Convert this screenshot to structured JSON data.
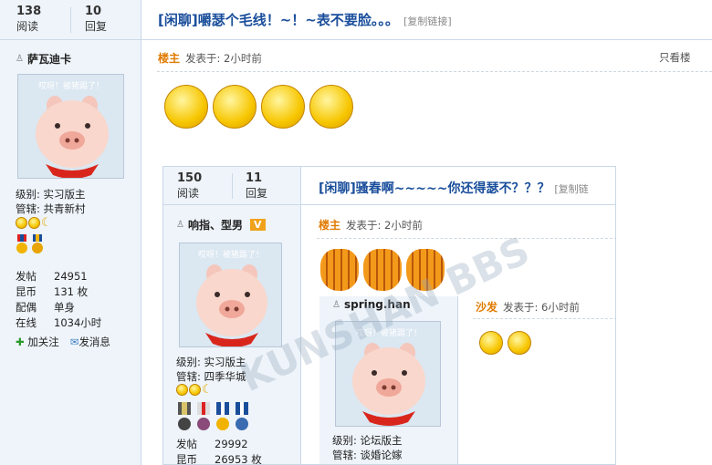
{
  "outer": {
    "stats": {
      "views": "138",
      "views_label": "阅读",
      "replies": "10",
      "replies_label": "回复"
    },
    "title": "[闲聊]嚼瑟个毛线！~！~表不要脸。。。",
    "copy_link": "[复制链接]",
    "user": {
      "name": "萨瓦迪卡",
      "level": "级别: 实习版主",
      "manage": "管辖: 共青新村",
      "posts_k": "发帖",
      "posts_v": "24951",
      "coins_k": "昆币",
      "coins_v": "131 枚",
      "spouse_k": "配偶",
      "spouse_v": "单身",
      "online_k": "在线",
      "online_v": "1034小时",
      "follow": "加关注",
      "message": "发消息"
    },
    "post": {
      "badge": "楼主",
      "meta": "发表于: 2小时前",
      "only_view": "只看楼"
    }
  },
  "mid": {
    "stats": {
      "views": "150",
      "views_label": "阅读",
      "replies": "11",
      "replies_label": "回复"
    },
    "title": "[闲聊]骚春啊~~~~~你还得瑟不？？？",
    "copy_link": "[复制链",
    "user": {
      "name": "响指、型男",
      "vip": "V",
      "level": "级别: 实习版主",
      "manage": "管辖: 四季华城",
      "posts_k": "发帖",
      "posts_v": "29992",
      "coins_k": "昆币",
      "coins_v": "26953 枚"
    },
    "post": {
      "badge": "楼主",
      "meta": "发表于: 2小时前"
    }
  },
  "inner": {
    "user": {
      "name": "spring.han",
      "level": "级别: 论坛版主",
      "manage": "管辖: 谈婚论嫁"
    },
    "post": {
      "badge": "沙发",
      "meta": "发表于: 6小时前"
    }
  },
  "avatar_text": "哎呀！被猪踢了！",
  "watermark": "KUNSHAN BBS",
  "colors": {
    "accent": "#1a4e9b",
    "owner": "#e07a00",
    "panel": "#eef4fa"
  }
}
